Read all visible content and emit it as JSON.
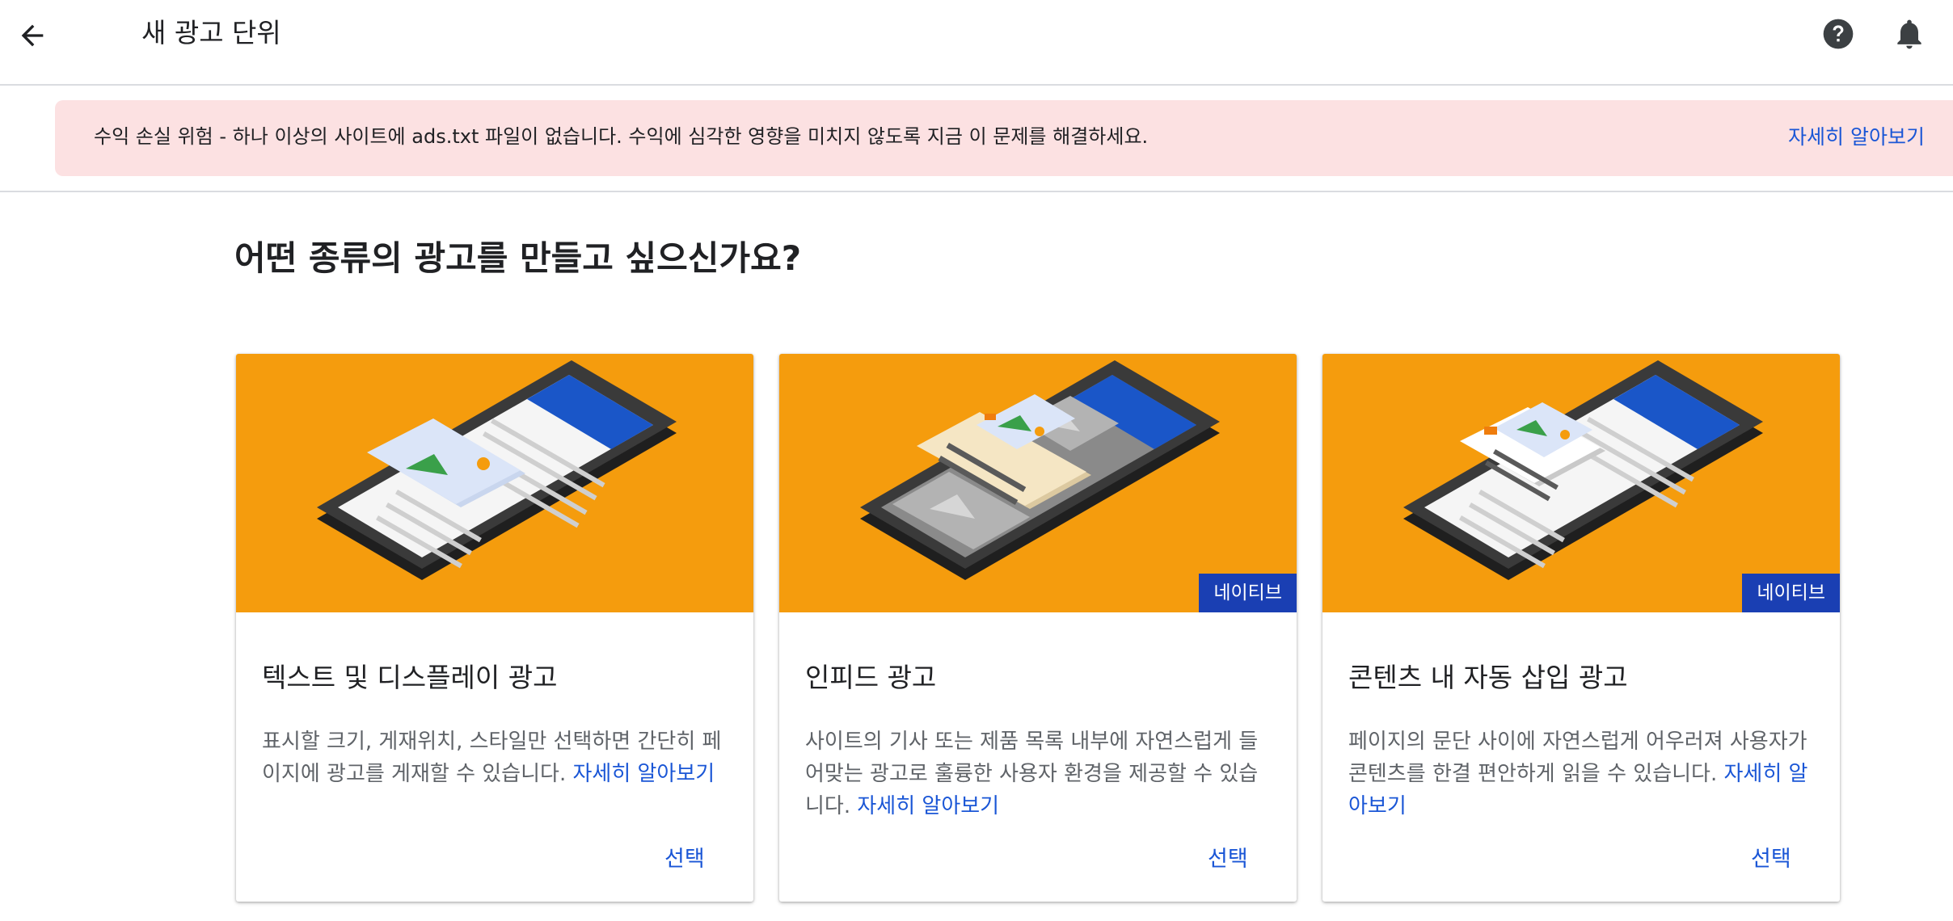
{
  "header": {
    "title": "새 광고 단위",
    "back_icon": "arrow-left-icon",
    "help_icon": "help-circle-icon",
    "notifications_icon": "bell-icon"
  },
  "alert": {
    "message": "수익 손실 위험 - 하나 이상의 사이트에 ads.txt 파일이 없습니다. 수익에 심각한 영향을 미치지 않도록 지금 이 문제를 해결하세요.",
    "link": "자세히 알아보기",
    "background_color": "#fce1e2"
  },
  "main": {
    "question": "어떤 종류의 광고를 만들고 싶으신가요?"
  },
  "cards": [
    {
      "title": "텍스트 및 디스플레이 광고",
      "description": "표시할 크기, 게재위치, 스타일만 선택하면 간단히 페이지에 광고를 게재할 수 있습니다.",
      "link": "자세히 알아보기",
      "badge": "",
      "select_label": "선택"
    },
    {
      "title": "인피드 광고",
      "description": "사이트의 기사 또는 제품 목록 내부에 자연스럽게 들어맞는 광고로 훌륭한 사용자 환경을 제공할 수 있습니다.",
      "link": "자세히 알아보기",
      "badge": "네이티브",
      "select_label": "선택"
    },
    {
      "title": "콘텐츠 내 자동 삽입 광고",
      "description": "페이지의 문단 사이에 자연스럽게 어우러져 사용자가 콘텐츠를 한결 편안하게 읽을 수 있습니다.",
      "link": "자세히 알아보기",
      "badge": "네이티브",
      "select_label": "선택"
    }
  ],
  "colors": {
    "accent": "#1a56d6",
    "illustration_bg": "#f59c0d",
    "badge_bg": "#1a3fb3"
  }
}
